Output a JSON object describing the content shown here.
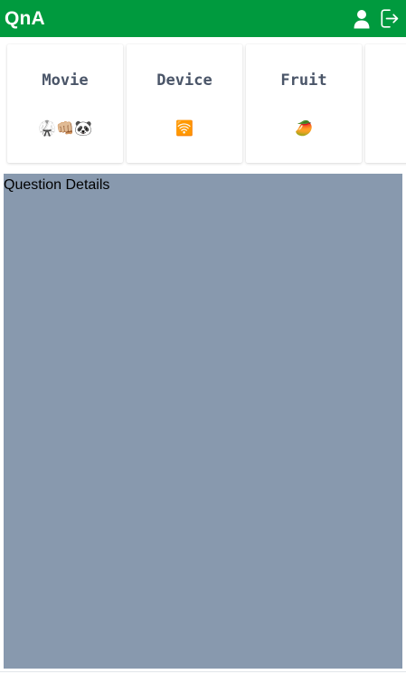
{
  "header": {
    "title": "QnA",
    "background_color": "#009a3e",
    "actions": [
      {
        "icon": "user-icon"
      },
      {
        "icon": "logout-icon"
      }
    ]
  },
  "categories": [
    {
      "label": "Movie",
      "emoji": "🥋👊🏼🐼"
    },
    {
      "label": "Device",
      "emoji": "🛜"
    },
    {
      "label": "Fruit",
      "emoji": "🥭"
    },
    {
      "label": "",
      "emoji": ""
    }
  ],
  "details": {
    "label": "Question Details",
    "background_color": "#8899ae"
  }
}
